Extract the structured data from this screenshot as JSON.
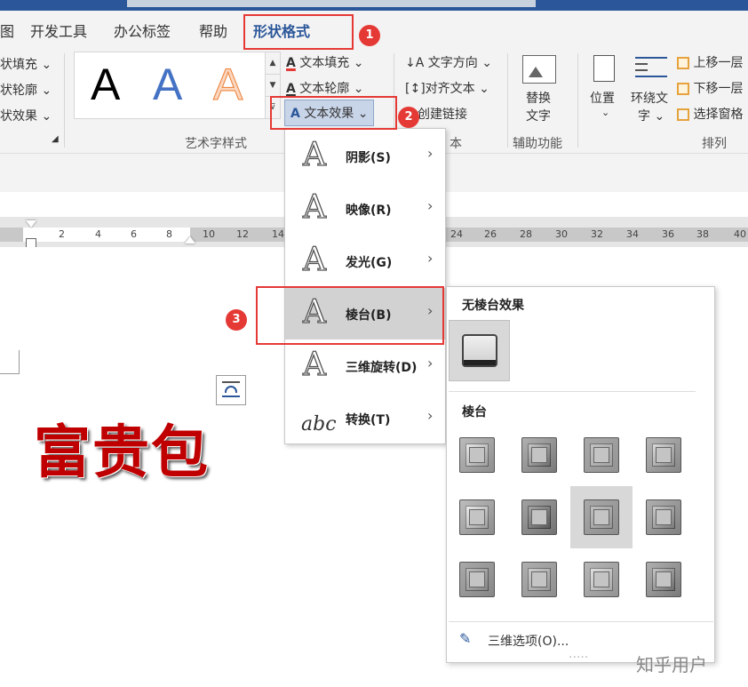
{
  "ribbon_tabs": [
    "图",
    "开发工具",
    "办公标签",
    "帮助",
    "形状格式"
  ],
  "shape_styles_items": [
    "状填充",
    "状轮廓",
    "状效果"
  ],
  "wordart": {
    "gallery_letters": [
      "A",
      "A",
      "A"
    ],
    "text_fill": "文本填充",
    "text_outline": "文本轮廓",
    "text_effects": "文本效果",
    "group_label": "艺术字样式"
  },
  "text_group": {
    "direction": "文字方向",
    "align": "对齐文本",
    "link": "创建链接",
    "group_label_partial": "本"
  },
  "accessibility": {
    "alt_text_line1": "替换",
    "alt_text_line2": "文字",
    "group_label": "辅助功能"
  },
  "arrange": {
    "position": "位置",
    "wrap_line1": "环绕文",
    "wrap_line2": "字",
    "bring_forward": "上移一层",
    "send_backward": "下移一层",
    "selection_pane": "选择窗格",
    "group_label": "排列"
  },
  "ruler_labels": [
    "2",
    "4",
    "6",
    "8",
    "10",
    "12",
    "14",
    "24",
    "26",
    "28",
    "30",
    "32",
    "34",
    "36",
    "38",
    "40"
  ],
  "document": {
    "wordart_text": "富贵包"
  },
  "text_effects_menu": [
    {
      "label": "阴影(S)",
      "icon": "A",
      "highlighted": false
    },
    {
      "label": "映像(R)",
      "icon": "A",
      "highlighted": false
    },
    {
      "label": "发光(G)",
      "icon": "A",
      "highlighted": false
    },
    {
      "label": "棱台(B)",
      "icon": "A",
      "highlighted": true
    },
    {
      "label": "三维旋转(D)",
      "icon": "A",
      "highlighted": false
    },
    {
      "label": "转换(T)",
      "icon": "abc",
      "highlighted": false
    }
  ],
  "bevel_submenu": {
    "no_bevel_header": "无棱台效果",
    "bevel_header": "棱台",
    "options_3d": "三维选项(O)...",
    "preset_count": 12,
    "selected_preset_index": 6
  },
  "annotations": [
    "1",
    "2",
    "3"
  ],
  "watermark": "知乎用户",
  "colors": {
    "accent": "#2b579a",
    "annotation_red": "#e53935",
    "wordart_red": "#c00000",
    "highlight": "#d2d2d2"
  }
}
